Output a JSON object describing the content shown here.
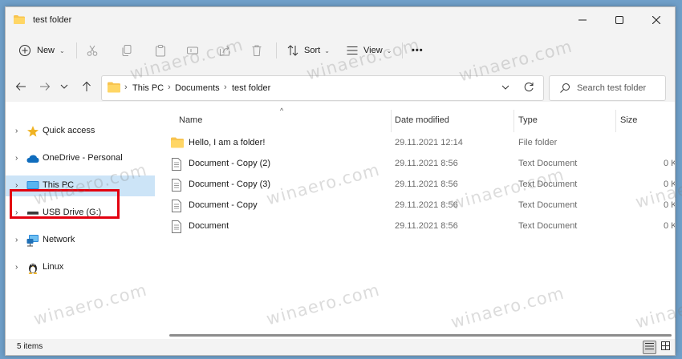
{
  "window": {
    "title": "test folder",
    "controls": [
      "minimize",
      "maximize",
      "close"
    ]
  },
  "toolbar": {
    "new_label": "New",
    "sort_label": "Sort",
    "view_label": "View",
    "more_label": "•••"
  },
  "address_bar": {
    "breadcrumbs": [
      "This PC",
      "Documents",
      "test folder"
    ]
  },
  "search": {
    "placeholder": "Search test folder"
  },
  "nav_pane": {
    "items": [
      {
        "label": "Quick access",
        "icon": "star-icon",
        "selected": false
      },
      {
        "label": "OneDrive - Personal",
        "icon": "cloud-icon",
        "selected": false
      },
      {
        "label": "This PC",
        "icon": "monitor-icon",
        "selected": true
      },
      {
        "label": "USB Drive (G:)",
        "icon": "usb-drive-icon",
        "selected": false
      },
      {
        "label": "Network",
        "icon": "network-icon",
        "selected": false
      },
      {
        "label": "Linux",
        "icon": "linux-penguin-icon",
        "selected": false
      }
    ]
  },
  "file_list": {
    "columns": {
      "name": "Name",
      "date_modified": "Date modified",
      "type": "Type",
      "size": "Size"
    },
    "rows": [
      {
        "name": "Hello, I am a folder!",
        "date": "29.11.2021 12:14",
        "type": "File folder",
        "size": "",
        "icon": "folder-icon"
      },
      {
        "name": "Document - Copy (2)",
        "date": "29.11.2021 8:56",
        "type": "Text Document",
        "size": "0 K",
        "icon": "text-document-icon"
      },
      {
        "name": "Document - Copy (3)",
        "date": "29.11.2021 8:56",
        "type": "Text Document",
        "size": "0 K",
        "icon": "text-document-icon"
      },
      {
        "name": "Document - Copy",
        "date": "29.11.2021 8:56",
        "type": "Text Document",
        "size": "0 K",
        "icon": "text-document-icon"
      },
      {
        "name": "Document",
        "date": "29.11.2021 8:56",
        "type": "Text Document",
        "size": "0 K",
        "icon": "text-document-icon"
      }
    ]
  },
  "status_bar": {
    "item_count": "5 items"
  },
  "watermark": "winaero.com",
  "colors": {
    "accent": "#0067c0",
    "selection": "#cce4f7",
    "highlight_box": "#e3000f",
    "folder": "#f8c450"
  }
}
